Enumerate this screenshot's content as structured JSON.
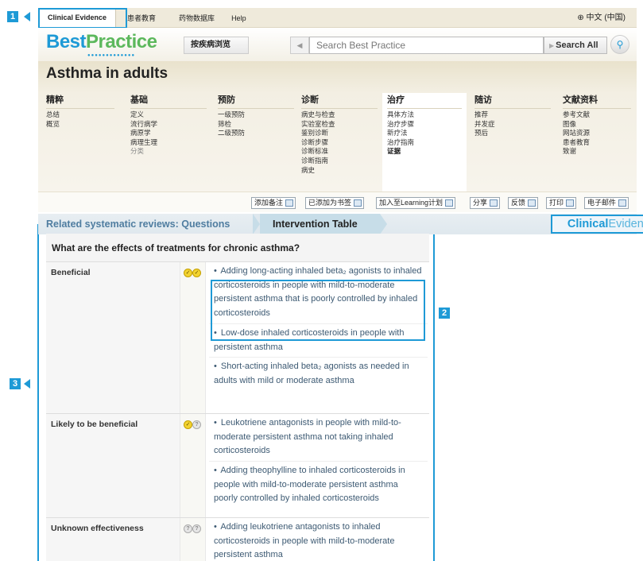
{
  "markers": {
    "m1_top": "1",
    "m1_logo": "1",
    "m2": "2",
    "m3": "3"
  },
  "topnav": {
    "items": [
      "Clinical Evidence",
      "患者教育",
      "药物数据库",
      "Help"
    ],
    "language": "中文 (中国)"
  },
  "header": {
    "logo_part1": "Best",
    "logo_part2": "Practice",
    "browse_label": "按疾病浏览",
    "search_placeholder": "Search Best Practice",
    "search_all_label": "Search All"
  },
  "topic": {
    "title": "Asthma in adults",
    "columns": [
      {
        "head": "精粹",
        "links": [
          "总结",
          "概览"
        ]
      },
      {
        "head": "基础",
        "links": [
          "定义",
          "流行病学",
          "病原学",
          "病理生理",
          "分类"
        ]
      },
      {
        "head": "预防",
        "links": [
          "一级预防",
          "筛检",
          "二级预防"
        ]
      },
      {
        "head": "诊断",
        "links": [
          "病史与检查",
          "实验室检查",
          "鉴别诊断",
          "诊断步骤",
          "诊断标准",
          "诊断指南",
          "病史"
        ]
      },
      {
        "head": "治疗",
        "links": [
          "具体方法",
          "治疗步骤",
          "新疗法",
          "治疗指南",
          "证据"
        ]
      },
      {
        "head": "随访",
        "links": [
          "推荐",
          "并发症",
          "预后"
        ]
      },
      {
        "head": "文献资料",
        "links": [
          "参考文献",
          "图像",
          "网站资源",
          "患者教育",
          "致谢"
        ]
      }
    ]
  },
  "actions": [
    "添加备注",
    "已添加为书签",
    "加入至Learning计划",
    "分享",
    "反馈",
    "打印",
    "电子邮件"
  ],
  "breadcrumb": {
    "first": "Related systematic reviews: Questions",
    "second": "Intervention Table",
    "ce_part1": "Clinical",
    "ce_part2": "Evidence"
  },
  "table": {
    "title": "What are the effects of treatments for chronic asthma?",
    "rows": [
      {
        "category": "Beneficial",
        "evidence": "beneficial",
        "items": [
          "Adding long-acting inhaled beta₂ agonists to inhaled corticosteroids in people with mild-to-moderate persistent asthma that is poorly controlled by inhaled corticosteroids",
          "Low-dose inhaled corticosteroids in people with persistent asthma",
          "Short-acting inhaled beta₂ agonists as needed in adults with mild or moderate asthma"
        ]
      },
      {
        "category": "Likely to be beneficial",
        "evidence": "likely",
        "items": [
          "Leukotriene antagonists in people with mild-to-moderate persistent asthma not taking inhaled corticosteroids",
          "Adding theophylline to inhaled corticosteroids in people with mild-to-moderate persistent asthma poorly controlled by inhaled corticosteroids"
        ]
      },
      {
        "category": "Unknown effectiveness",
        "evidence": "unknown",
        "items": [
          "Adding leukotriene antagonists to inhaled corticosteroids in people with mild-to-moderate persistent asthma"
        ]
      }
    ]
  },
  "colors": {
    "accent": "#1e9ad6",
    "link": "#3d5a73",
    "crumb": "#4f7da0"
  }
}
